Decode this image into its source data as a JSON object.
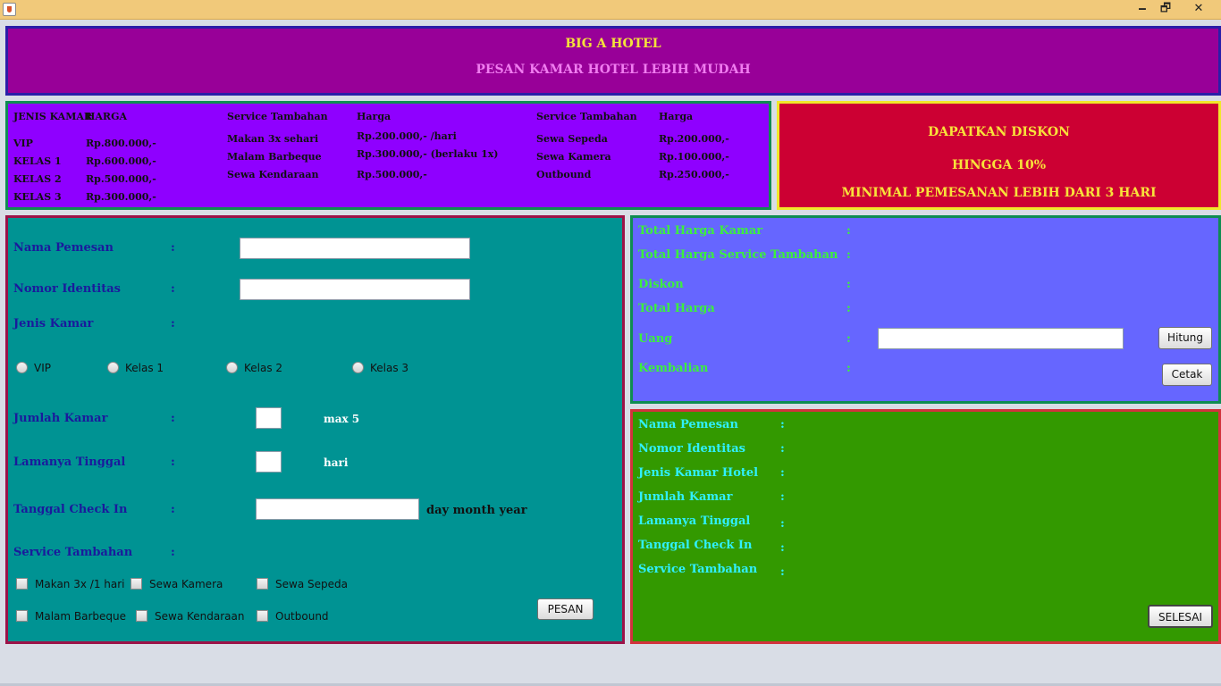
{
  "window": {
    "minimize": "🗕",
    "maximize": "🗗",
    "close": "✕"
  },
  "header": {
    "title": "BIG A HOTEL",
    "subtitle": "PESAN KAMAR HOTEL LEBIH MUDAH"
  },
  "prices": {
    "room": {
      "head_type": "JENIS KAMAR",
      "head_price": "HARGA",
      "rows": [
        {
          "name": "VIP",
          "price": "Rp.800.000,-"
        },
        {
          "name": "KELAS 1",
          "price": "Rp.600.000,-"
        },
        {
          "name": "KELAS 2",
          "price": "Rp.500.000,-"
        },
        {
          "name": "KELAS 3",
          "price": "Rp.300.000,-"
        }
      ]
    },
    "service1": {
      "head_service": "Service Tambahan",
      "head_price": "Harga",
      "rows": [
        {
          "name": "Makan 3x sehari",
          "price": "Rp.200.000,- /hari"
        },
        {
          "name": "Malam Barbeque",
          "price": "Rp.300.000,- (berlaku 1x)"
        },
        {
          "name": "Sewa Kendaraan",
          "price": "Rp.500.000,-"
        }
      ]
    },
    "service2": {
      "head_service": "Service Tambahan",
      "head_price": "Harga",
      "rows": [
        {
          "name": "Sewa Sepeda",
          "price": "Rp.200.000,-"
        },
        {
          "name": "Sewa Kamera",
          "price": "Rp.100.000,-"
        },
        {
          "name": "Outbound",
          "price": "Rp.250.000,-"
        }
      ]
    }
  },
  "discount": {
    "line1": "DAPATKAN DISKON",
    "line2": "HINGGA 10%",
    "line3": "MINIMAL PEMESANAN LEBIH DARI 3 HARI"
  },
  "form": {
    "colon": ":",
    "nama_label": "Nama Pemesan",
    "nama_value": "",
    "identitas_label": "Nomor Identitas",
    "identitas_value": "",
    "jenis_label": "Jenis Kamar",
    "room_options": [
      "VIP",
      "Kelas 1",
      "Kelas 2",
      "Kelas 3"
    ],
    "jumlah_label": "Jumlah Kamar",
    "jumlah_value": "",
    "jumlah_hint": "max 5",
    "lama_label": "Lamanya Tinggal",
    "lama_value": "",
    "lama_hint": "hari",
    "checkin_label": "Tanggal Check In",
    "checkin_value": "",
    "checkin_hint": "day month year",
    "service_label": "Service Tambahan",
    "services": [
      "Makan 3x /1 hari",
      "Sewa Kamera",
      "Sewa Sepeda",
      "Malam Barbeque",
      "Sewa Kendaraan",
      "Outbound"
    ],
    "pesan_button": "PESAN"
  },
  "totals": {
    "colon": ":",
    "kamar_label": "Total Harga Kamar",
    "service_label": "Total Harga Service Tambahan",
    "diskon_label": "Diskon",
    "total_label": "Total Harga",
    "uang_label": "Uang",
    "uang_value": "",
    "kembalian_label": "Kembalian",
    "hitung_button": "Hitung",
    "cetak_button": "Cetak"
  },
  "summary": {
    "colon": ":",
    "nama_label": "Nama Pemesan",
    "identitas_label": "Nomor Identitas",
    "jenis_label": "Jenis Kamar Hotel",
    "jumlah_label": "Jumlah Kamar",
    "lama_label": "Lamanya Tinggal",
    "checkin_label": "Tanggal Check In",
    "service_label": "Service Tambahan",
    "selesai_button": "SELESAI"
  }
}
